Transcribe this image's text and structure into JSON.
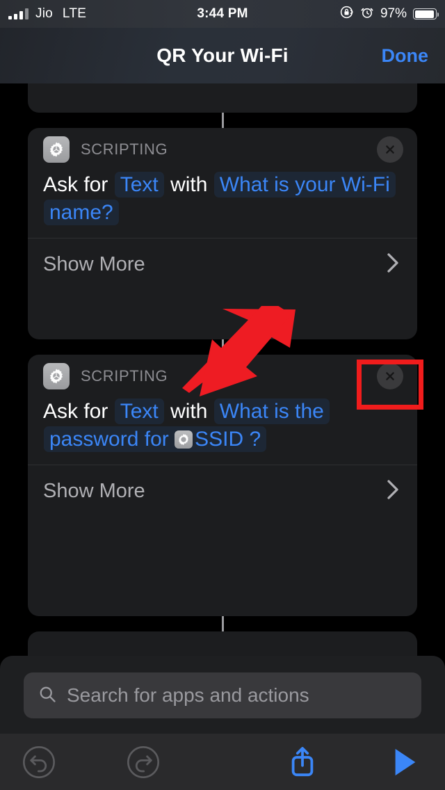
{
  "status_bar": {
    "carrier": "Jio",
    "network": "LTE",
    "time": "3:44 PM",
    "battery_percent": "97%",
    "signal_bars_filled": 3,
    "signal_bars_total": 4,
    "icons": [
      "rotation-lock-icon",
      "alarm-clock-icon",
      "battery-icon"
    ]
  },
  "nav_bar": {
    "title": "QR Your Wi-Fi",
    "done_label": "Done"
  },
  "cards": [
    {
      "category": "SCRIPTING",
      "app_icon": "gear-icon",
      "close_icon": "close-circle-icon",
      "phrase": {
        "prefix": "Ask for",
        "type_token": "Text",
        "middle": "with",
        "prompt_token": "What is your Wi-Fi name?",
        "prompt_has_variable": false
      },
      "show_more_label": "Show More",
      "chevron_icon": "chevron-right-icon",
      "highlighted": false
    },
    {
      "category": "SCRIPTING",
      "app_icon": "gear-icon",
      "close_icon": "close-circle-icon",
      "phrase": {
        "prefix": "Ask for",
        "type_token": "Text",
        "middle": "with",
        "prompt_part1": "What is the password for",
        "variable_name": "SSID",
        "variable_icon": "gear-icon",
        "prompt_part2": "?",
        "prompt_has_variable": true
      },
      "show_more_label": "Show More",
      "chevron_icon": "chevron-right-icon",
      "highlighted": true
    }
  ],
  "search": {
    "placeholder": "Search for apps and actions",
    "icon": "search-icon"
  },
  "toolbar": {
    "undo_icon": "undo-icon",
    "redo_icon": "redo-icon",
    "share_icon": "share-icon",
    "play_icon": "play-icon"
  },
  "annotations": {
    "arrow_icon": "red-arrow-pointing-down-left",
    "arrow_color": "#ee1c23",
    "highlight_color": "#f01c1c",
    "highlight_target": "close-circle-icon-card-2"
  },
  "colors": {
    "accent_blue": "#3b86f7",
    "card_bg": "#1c1d1f",
    "page_bg": "#000000",
    "token_bg": "#1d2735",
    "muted_text": "#8e8e93"
  }
}
